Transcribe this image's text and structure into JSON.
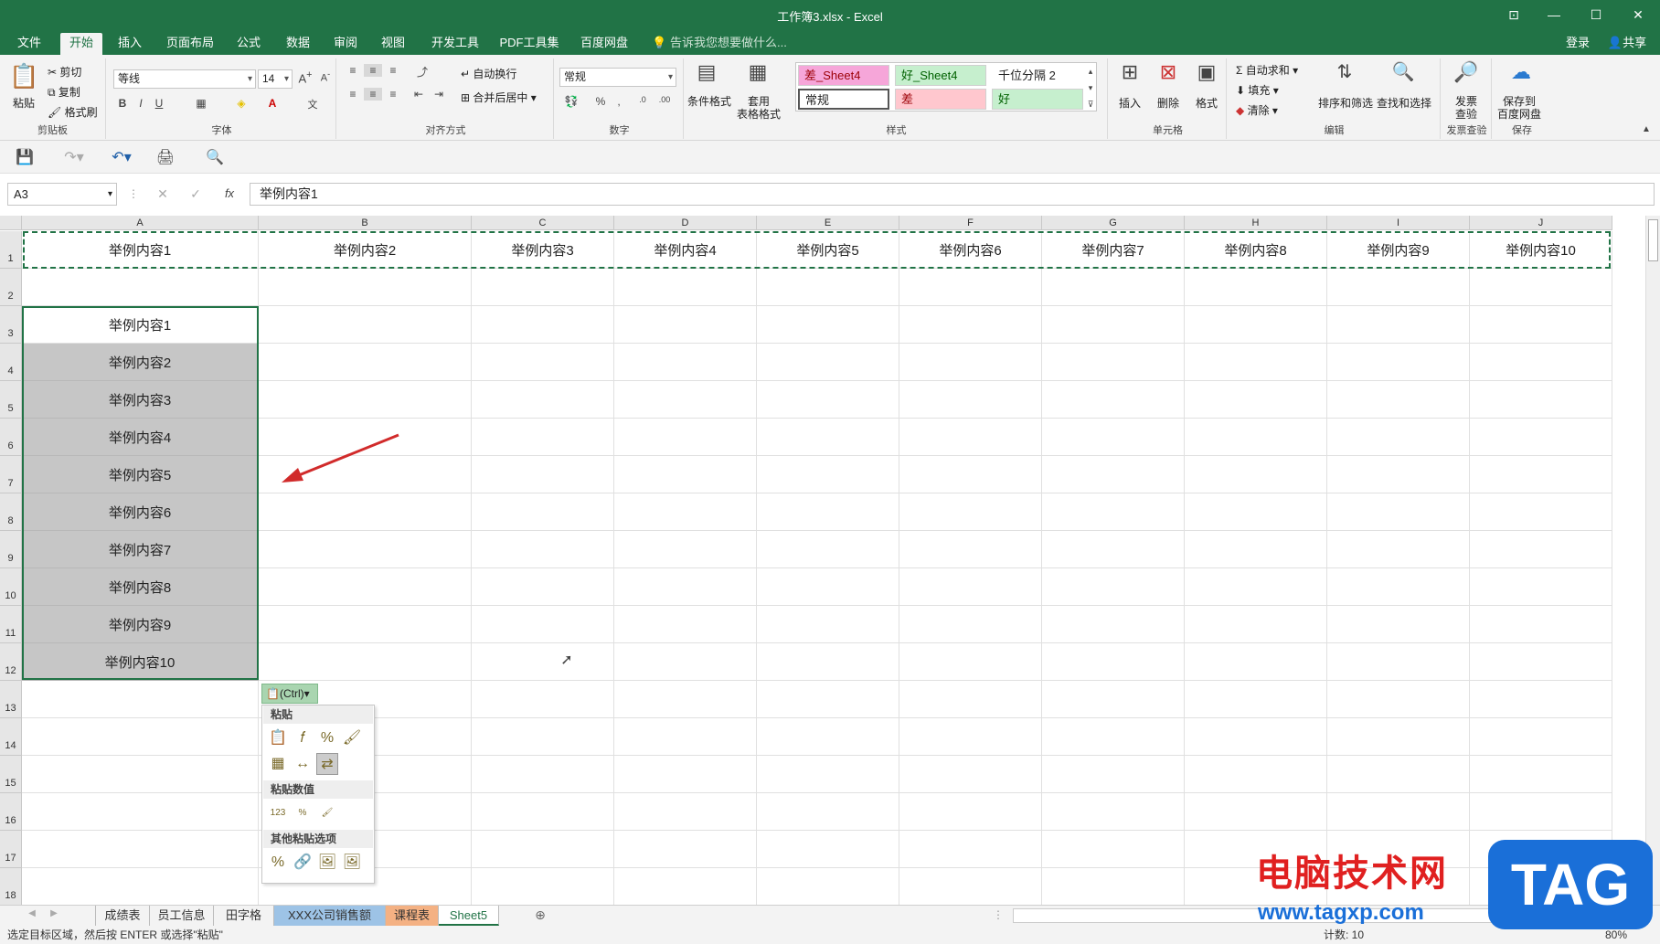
{
  "window": {
    "title": "工作簿3.xlsx - Excel",
    "min": "—",
    "restore": "☐",
    "close": "✕",
    "ribbon_toggle": "⊡"
  },
  "tabs": [
    "文件",
    "开始",
    "插入",
    "页面布局",
    "公式",
    "数据",
    "审阅",
    "视图",
    "开发工具",
    "PDF工具集",
    "百度网盘"
  ],
  "active_tab": "开始",
  "tell_me": "告诉我您想要做什么...",
  "account": {
    "login": "登录",
    "share": "共享"
  },
  "ribbon": {
    "clipboard": {
      "label": "剪贴板",
      "paste": "粘贴",
      "cut": "剪切",
      "copy": "复制",
      "format_painter": "格式刷"
    },
    "font": {
      "label": "字体",
      "name": "等线",
      "size": "14",
      "bold": "B",
      "italic": "I",
      "underline": "U"
    },
    "align": {
      "label": "对齐方式",
      "wrap": "自动换行",
      "merge": "合并后居中"
    },
    "number": {
      "label": "数字",
      "format": "常规"
    },
    "styles": {
      "label": "样式",
      "cond_format": "条件格式",
      "table_format": "套用",
      "table_format2": "表格格式",
      "boxes": [
        {
          "text": "差_Sheet4",
          "bg": "#f6a6d9",
          "fg": "#9c0006"
        },
        {
          "text": "好_Sheet4",
          "bg": "#c6efce",
          "fg": "#006100"
        },
        {
          "text": "千位分隔 2",
          "bg": "#ffffff",
          "fg": "#222222"
        },
        {
          "text": "常规",
          "bg": "#ffffff",
          "fg": "#222222"
        },
        {
          "text": "差",
          "bg": "#ffc7ce",
          "fg": "#9c0006"
        },
        {
          "text": "好",
          "bg": "#c6efce",
          "fg": "#006100"
        }
      ]
    },
    "cells": {
      "label": "单元格",
      "insert": "插入",
      "delete": "删除",
      "format": "格式"
    },
    "edit": {
      "label": "编辑",
      "autosum": "自动求和",
      "fill": "填充",
      "clear": "清除",
      "sort": "排序和筛选",
      "find": "查找和选择"
    },
    "invoice": {
      "label": "发票查验",
      "btn": "发票",
      "btn2": "查验"
    },
    "save": {
      "label": "保存",
      "btn": "保存到",
      "btn2": "百度网盘"
    }
  },
  "formula_bar": {
    "name_box": "A3",
    "fx": "fx",
    "content": "举例内容1"
  },
  "columns": [
    "A",
    "B",
    "C",
    "D",
    "E",
    "F",
    "G",
    "H",
    "I",
    "J"
  ],
  "rows": [
    "1",
    "2",
    "3",
    "4",
    "5",
    "6",
    "7",
    "8",
    "9",
    "10",
    "11",
    "12",
    "13",
    "14",
    "15",
    "16",
    "17",
    "18"
  ],
  "row1": [
    "举例内容1",
    "举例内容2",
    "举例内容3",
    "举例内容4",
    "举例内容5",
    "举例内容6",
    "举例内容7",
    "举例内容8",
    "举例内容9",
    "举例内容10"
  ],
  "colA": [
    "举例内容1",
    "举例内容2",
    "举例内容3",
    "举例内容4",
    "举例内容5",
    "举例内容6",
    "举例内容7",
    "举例内容8",
    "举例内容9",
    "举例内容10"
  ],
  "paste_options": {
    "tag": "(Ctrl)",
    "h1": "粘贴",
    "h2": "粘贴数值",
    "h3": "其他粘贴选项"
  },
  "sheets": [
    "成绩表",
    "员工信息",
    "田字格",
    "XXX公司销售额",
    "课程表",
    "Sheet5"
  ],
  "active_sheet": "Sheet5",
  "status": "选定目标区域，然后按 ENTER 或选择\"粘贴\"",
  "status_right": "计数: 10",
  "zoom": "80%",
  "watermark": {
    "cn": "电脑技术网",
    "url": "www.tagxp.com",
    "logo": "TAG"
  },
  "colors": {
    "excel_green": "#217346",
    "selection_gray": "#c6c6c6"
  }
}
